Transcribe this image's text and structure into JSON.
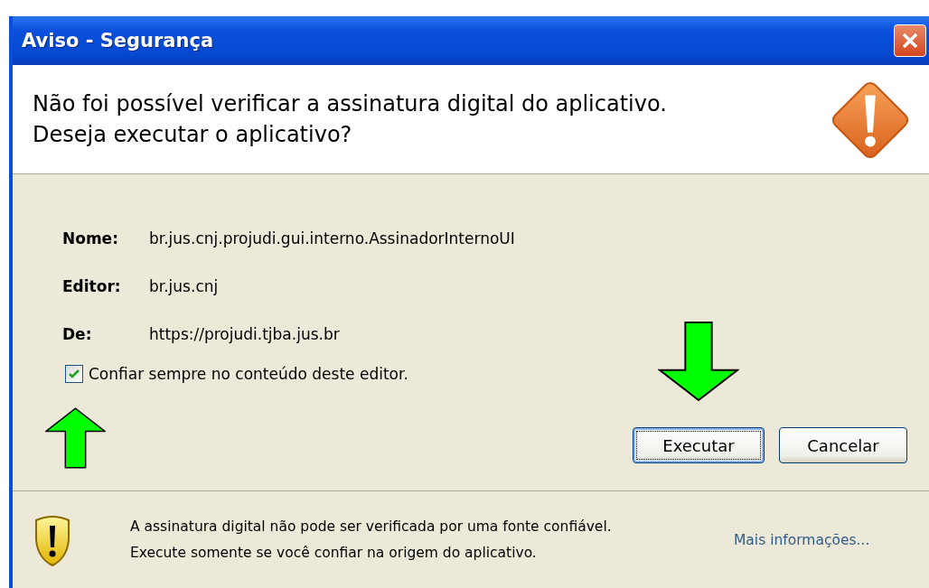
{
  "window": {
    "title": "Aviso - Segurança"
  },
  "header": {
    "message": "Não foi possível verificar a assinatura digital do aplicativo.  Deseja executar o aplicativo?"
  },
  "fields": [
    {
      "label": "Nome:",
      "value": "br.jus.cnj.projudi.gui.interno.AssinadorInternoUI"
    },
    {
      "label": "Editor:",
      "value": "br.jus.cnj"
    },
    {
      "label": "De:",
      "value": "https://projudi.tjba.jus.br"
    }
  ],
  "trust_checkbox": {
    "label": "Confiar sempre no conteúdo deste editor.",
    "checked": true
  },
  "buttons": [
    {
      "label": "Executar",
      "focused": true
    },
    {
      "label": "Cancelar",
      "focused": false
    }
  ],
  "footer": {
    "lines": [
      "A assinatura digital não pode ser verificada por uma fonte confiável.",
      "Execute somente se você confiar na origem do aplicativo."
    ],
    "link": "Mais informações..."
  }
}
